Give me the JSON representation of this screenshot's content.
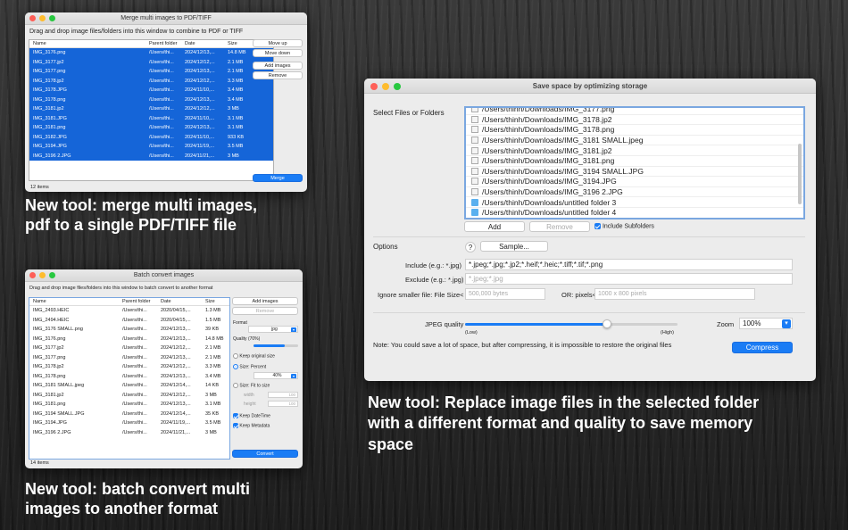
{
  "merge_window": {
    "title": "Merge multi images to PDF/TIFF",
    "instruction": "Drag and drop image files/folders into this window to combine to PDF or TIFF",
    "columns": [
      "Name",
      "Parent folder",
      "Date",
      "Size"
    ],
    "rows": [
      [
        "IMG_3176.png",
        "/Users/thi...",
        "2024/12/13,...",
        "14.8 MB"
      ],
      [
        "IMG_3177.jp2",
        "/Users/thi...",
        "2024/12/12,...",
        "2.1 MB"
      ],
      [
        "IMG_3177.png",
        "/Users/thi...",
        "2024/12/13,...",
        "2.1 MB"
      ],
      [
        "IMG_3178.jp2",
        "/Users/thi...",
        "2024/12/12,...",
        "3.3 MB"
      ],
      [
        "IMG_3178.JPG",
        "/Users/thi...",
        "2024/11/10,...",
        "3.4 MB"
      ],
      [
        "IMG_3178.png",
        "/Users/thi...",
        "2024/12/13,...",
        "3.4 MB"
      ],
      [
        "IMG_3181.jp2",
        "/Users/thi...",
        "2024/12/12,...",
        "3 MB"
      ],
      [
        "IMG_3181.JPG",
        "/Users/thi...",
        "2024/11/10,...",
        "3.1 MB"
      ],
      [
        "IMG_3181.png",
        "/Users/thi...",
        "2024/12/13,...",
        "3.1 MB"
      ],
      [
        "IMG_3182.JPG",
        "/Users/thi...",
        "2024/11/10,...",
        "933 KB"
      ],
      [
        "IMG_3194.JPG",
        "/Users/thi...",
        "2024/11/19,...",
        "3.5 MB"
      ],
      [
        "IMG_3196 2.JPG",
        "/Users/thi...",
        "2024/11/21,...",
        "3 MB"
      ]
    ],
    "buttons": {
      "move_up": "Move up",
      "move_down": "Move down",
      "add_images": "Add images",
      "remove": "Remove",
      "merge": "Merge"
    },
    "status": "12 items"
  },
  "caption_merge": {
    "line1": "New tool: merge multi images,",
    "line2": "pdf to a single PDF/TIFF file"
  },
  "convert_window": {
    "title": "Batch convert images",
    "instruction": "Drag and drop image files/folders into this window to batch convert to another format",
    "columns": [
      "Name",
      "Parent folder",
      "Date",
      "Size"
    ],
    "rows": [
      [
        "IMG_2493.HEIC",
        "/Users/thi...",
        "2020/04/15,...",
        "1.3 MB"
      ],
      [
        "IMG_2494.HEIC",
        "/Users/thi...",
        "2020/04/15,...",
        "1.5 MB"
      ],
      [
        "IMG_3176 SMALL.png",
        "/Users/thi...",
        "2024/12/13,...",
        "39 KB"
      ],
      [
        "IMG_3176.png",
        "/Users/thi...",
        "2024/12/13,...",
        "14.8 MB"
      ],
      [
        "IMG_3177.jp2",
        "/Users/thi...",
        "2024/12/12,...",
        "2.1 MB"
      ],
      [
        "IMG_3177.png",
        "/Users/thi...",
        "2024/12/13,...",
        "2.1 MB"
      ],
      [
        "IMG_3178.jp2",
        "/Users/thi...",
        "2024/12/12,...",
        "3.3 MB"
      ],
      [
        "IMG_3178.png",
        "/Users/thi...",
        "2024/12/13,...",
        "3.4 MB"
      ],
      [
        "IMG_3181 SMALL.jpeg",
        "/Users/thi...",
        "2024/12/14,...",
        "14 KB"
      ],
      [
        "IMG_3181.jp2",
        "/Users/thi...",
        "2024/12/12,...",
        "3 MB"
      ],
      [
        "IMG_3181.png",
        "/Users/thi...",
        "2024/12/13,...",
        "3.1 MB"
      ],
      [
        "IMG_3194 SMALL.JPG",
        "/Users/thi...",
        "2024/12/14,...",
        "35 KB"
      ],
      [
        "IMG_3194.JPG",
        "/Users/thi...",
        "2024/11/19,...",
        "3.5 MB"
      ],
      [
        "IMG_3196 2.JPG",
        "/Users/thi...",
        "2024/11/21,...",
        "3 MB"
      ]
    ],
    "add_images": "Add images",
    "remove": "Remove",
    "format_label": "Format",
    "format_value": "jpg",
    "quality_label": "Quality (70%)",
    "quality": 0.7,
    "keep_original": "Keep original size",
    "size_percent": "Size: Percent",
    "percent_value": "40%",
    "size_fit": "Size: Fit to size",
    "width_label": "width",
    "height_label": "height",
    "width_value": "100",
    "height_value": "100",
    "keep_datetime": "Keep DateTime",
    "keep_metadata": "Keep Metadata",
    "convert": "Convert",
    "status": "14 items"
  },
  "caption_convert": {
    "line1": "New tool: batch convert multi",
    "line2": "images to another format"
  },
  "optimize_window": {
    "title": "Save space by optimizing storage",
    "select_label": "Select Files or Folders",
    "files": [
      {
        "path": "/Users/thinh/Downloads/IMG_3177.png",
        "type": "file"
      },
      {
        "path": "/Users/thinh/Downloads/IMG_3178.jp2",
        "type": "file"
      },
      {
        "path": "/Users/thinh/Downloads/IMG_3178.png",
        "type": "file"
      },
      {
        "path": "/Users/thinh/Downloads/IMG_3181 SMALL.jpeg",
        "type": "file"
      },
      {
        "path": "/Users/thinh/Downloads/IMG_3181.jp2",
        "type": "file"
      },
      {
        "path": "/Users/thinh/Downloads/IMG_3181.png",
        "type": "file"
      },
      {
        "path": "/Users/thinh/Downloads/IMG_3194 SMALL.JPG",
        "type": "file"
      },
      {
        "path": "/Users/thinh/Downloads/IMG_3194.JPG",
        "type": "file"
      },
      {
        "path": "/Users/thinh/Downloads/IMG_3196 2.JPG",
        "type": "file"
      },
      {
        "path": "/Users/thinh/Downloads/untitled folder 3",
        "type": "folder"
      },
      {
        "path": "/Users/thinh/Downloads/untitled folder 4",
        "type": "folder"
      }
    ],
    "add": "Add",
    "remove": "Remove",
    "include_subfolders": "Include Subfolders",
    "options_label": "Options",
    "help": "?",
    "sample": "Sample...",
    "include_label": "Include (e.g.: *.jpg)",
    "include_value": "*.jpeg;*.jpg;*.jp2;*.heif;*.heic;*.tiff;*.tif;*.png",
    "exclude_label": "Exclude (e.g.: *.jpg)",
    "exclude_placeholder": "*.jpeg;*.jpg",
    "ignore_label": "Ignore smaller file: File Size<",
    "ignore_placeholder": "500,000 bytes",
    "pixels_label": "OR: pixels<",
    "pixels_placeholder": "1000 x 800 pixels",
    "jpeg_quality_label": "JPEG quality",
    "jpeg_quality": 0.67,
    "low": "(Low)",
    "high": "(High)",
    "zoom_label": "Zoom",
    "zoom_value": "100%",
    "note": "Note: You could save a lot of space, but after compressing, it is impossible to restore the original files",
    "compress": "Compress"
  },
  "caption_optimize": {
    "line1": "New tool: Replace image files in the selected folder",
    "line2": "with a different format and quality to save memory",
    "line3": "space"
  },
  "colors": {
    "accent": "#1a7cf5",
    "selection": "#1565d8"
  }
}
